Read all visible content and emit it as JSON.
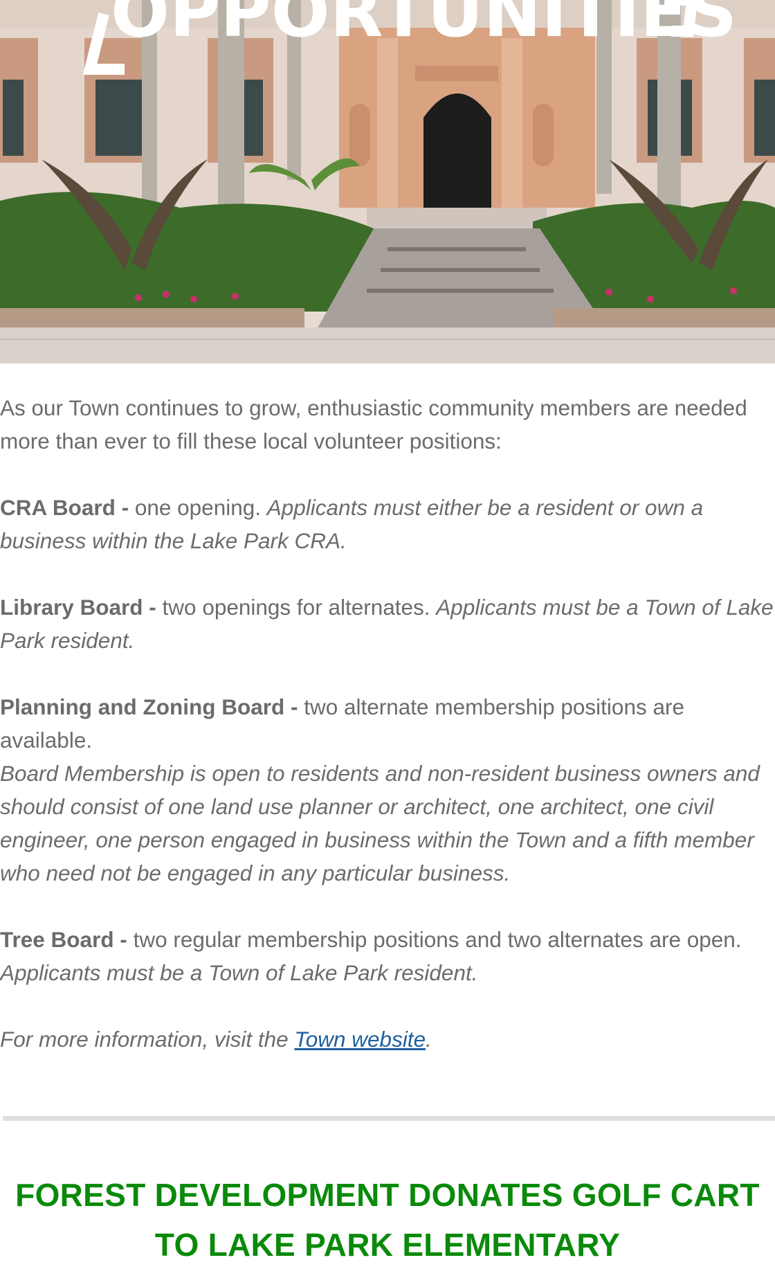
{
  "hero": {
    "alt": "Town Hall building entrance with landscaped walkway",
    "overlay_text": "OPPORTUNITIES"
  },
  "intro": "As our Town continues to grow, enthusiastic community members are needed more than ever to fill these local volunteer positions:",
  "boards": [
    {
      "name": "CRA Board -",
      "desc": " one opening.  ",
      "note": "Applicants must either be a resident or own a business within the Lake Park CRA."
    },
    {
      "name": "Library Board -",
      "desc": " two openings for alternates. ",
      "note": "Applicants must be a Town of Lake Park resident."
    },
    {
      "name": "Planning and Zoning Board -",
      "desc": " two alternate membership positions are available.",
      "note": "Board Membership is open to residents and non-resident business owners and should consist of one land use planner or architect, one architect, one civil engineer, one person engaged in business within the Town and a fifth member who need not be engaged in any particular business."
    },
    {
      "name": "Tree Board -",
      "desc": " two regular membership positions and two alternates are open. ",
      "note": "Applicants must be a Town of Lake Park resident."
    }
  ],
  "more_info": {
    "prefix": "For more information, visit the ",
    "link_text": "Town website",
    "suffix": "."
  },
  "headline": {
    "line1": "FOREST DEVELOPMENT DONATES GOLF CART",
    "line2": "TO LAKE PARK ELEMENTARY"
  },
  "colors": {
    "headline": "#0a8a0a",
    "body_text": "#6b6b6b",
    "link": "#1f5fa0",
    "divider": "#dedede"
  }
}
